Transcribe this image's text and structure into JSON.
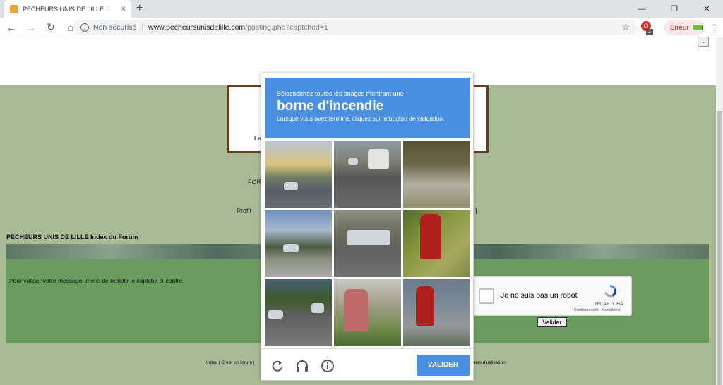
{
  "browser": {
    "tab_title": "PECHEURS UNIS DE LILLE ::",
    "tab_close": "×",
    "new_tab": "+",
    "window_minimize": "—",
    "window_restore": "❐",
    "window_close": "✕",
    "back": "←",
    "forward": "→",
    "reload": "↻",
    "home": "⌂",
    "security_label": "Non sécurisé",
    "url_host": "www.pecheursunisdelille.com",
    "url_path": "/posting.php?captched=1",
    "bookmark_star": "☆",
    "extension_badge": "2",
    "error_pill": "Erreur",
    "menu": "⋮"
  },
  "page": {
    "dropdown_glyph": "⌄",
    "logo_caption": "Le",
    "forum_link": "FOR",
    "profil_link": "Profil",
    "bracket": "]",
    "index_title": "PECHEURS UNIS DE LILLE Index du Forum",
    "message": "Pour valider votre message, merci de remplir le captcha ci-contre.",
    "valider_button": "Valider",
    "footer_links": "Index | Creer un forum |",
    "footer_right": "ales d'utilisation"
  },
  "recaptcha_widget": {
    "checkbox_label": "Je ne suis pas un robot",
    "brand": "reCAPTCHA",
    "links": "Confidentialité - Conditions"
  },
  "challenge": {
    "instruction": "Sélectionnez toutes les images montrant une",
    "target": "borne d'incendie",
    "sub_instruction": "Lorsque vous avez terminé, cliquez sur le bouton de validation.",
    "submit_label": "VALIDER",
    "tiles": [
      "street",
      "truck-road",
      "yard",
      "shop-street",
      "car-road",
      "fire-hydrant",
      "parked-cars",
      "fire-hydrant",
      "fire-hydrant"
    ]
  },
  "colors": {
    "challenge_blue": "#4a90e2",
    "page_green": "#a9ba97",
    "box_green": "#6a9c5f",
    "hydrant_red": "#b21f1f"
  }
}
